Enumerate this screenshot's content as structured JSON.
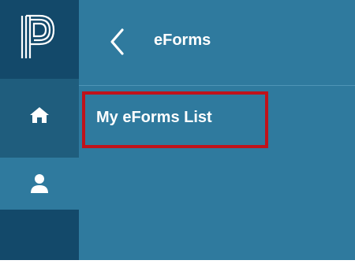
{
  "header": {
    "title": "eForms"
  },
  "menu": {
    "items": [
      {
        "label": "My eForms List"
      }
    ]
  },
  "icons": {
    "logo": "powerschool-logo-icon",
    "back": "chevron-left-icon",
    "home": "home-icon",
    "user": "user-icon"
  },
  "colors": {
    "panel": "#2f7a9e",
    "rail": "#1f5d7d",
    "rail_dark": "#13496a",
    "highlight_border": "#c0121b",
    "text": "#ffffff"
  }
}
